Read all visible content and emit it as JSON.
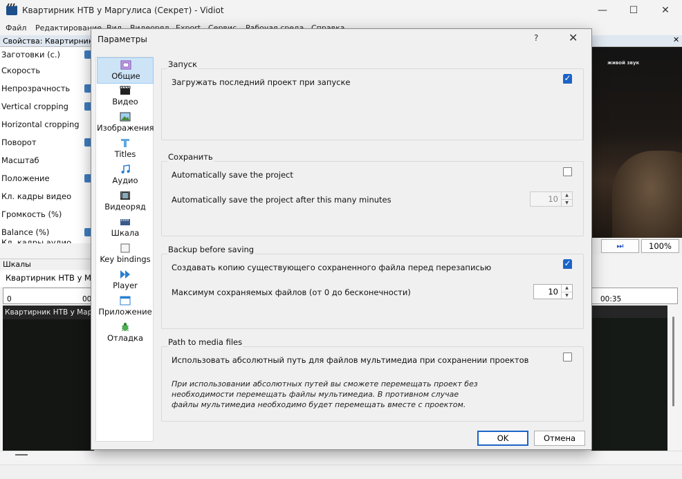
{
  "main": {
    "title": "Квартирник НТВ у Маргулиса  (Секрет) - Vidiot",
    "window_buttons": [
      "—",
      "☐",
      "✕"
    ],
    "menu": [
      "Файл",
      "Редактирование",
      "Вид",
      "Видеоряд",
      "Export",
      "Сервис",
      "Рабочая среда",
      "Справка"
    ],
    "properties_header": "Свойства: Квартирник Н",
    "properties": [
      "Заготовки (с.)",
      "Скорость",
      "Непрозрачность",
      "Vertical cropping",
      "Horizontal cropping",
      "Поворот",
      "Масштаб",
      "Положение",
      "Кл. кадры видео",
      "Громкость (%)",
      "Balance (%)",
      "Кл. кадры аудио"
    ],
    "timelines_header": "Шкалы",
    "timeline_tab": "Квартирник НТВ у Ма",
    "ruler_left": [
      "0",
      "00"
    ],
    "clip_title": "Квартирник НТВ у Маргулиса",
    "preview_caption": "живой звук",
    "zoom": "100%",
    "ruler_right": "00:35"
  },
  "dialog": {
    "title": "Параметры",
    "help": "?",
    "close": "✕",
    "categories": [
      {
        "label": "Общие",
        "icon": "general-icon",
        "selected": true
      },
      {
        "label": "Видео",
        "icon": "clapper-icon"
      },
      {
        "label": "Изображения",
        "icon": "image-icon"
      },
      {
        "label": "Titles",
        "icon": "titles-icon"
      },
      {
        "label": "Аудио",
        "icon": "music-note-icon"
      },
      {
        "label": "Видеоряд",
        "icon": "film-strip-icon"
      },
      {
        "label": "Шкала",
        "icon": "timeline-icon"
      },
      {
        "label": "Key bindings",
        "icon": "key-bindings-icon"
      },
      {
        "label": "Player",
        "icon": "player-icon"
      },
      {
        "label": "Приложение",
        "icon": "application-icon"
      },
      {
        "label": "Отладка",
        "icon": "bug-icon"
      }
    ],
    "startup": {
      "title": "Запуск",
      "load_last_label": "Загружать последний проект при запуске",
      "load_last_checked": true
    },
    "save": {
      "title": "Сохранить",
      "autosave_label": "Automatically save the project",
      "autosave_checked": false,
      "interval_label": "Automatically save the project after this many minutes",
      "interval_value": "10"
    },
    "backup": {
      "title": "Backup before saving",
      "copy_label": "Создавать копию существующего сохраненного файла перед перезаписью",
      "copy_checked": true,
      "max_label": "Максимум сохраняемых файлов (от 0 до бесконечности)",
      "max_value": "10"
    },
    "media": {
      "title": "Path to media files",
      "absolute_label": "Использовать абсолютный путь для файлов мультимедиа при сохранении проектов",
      "absolute_checked": false,
      "note_lines": [
        "При использовании абсолютных путей вы сможете перемещать проект без",
        "необходимости перемещать файлы мультимедиа. В противном случае",
        "файлы мультимедиа необходимо будет перемещать вместе с проектом."
      ]
    },
    "ok": "OK",
    "cancel": "Отмена"
  }
}
